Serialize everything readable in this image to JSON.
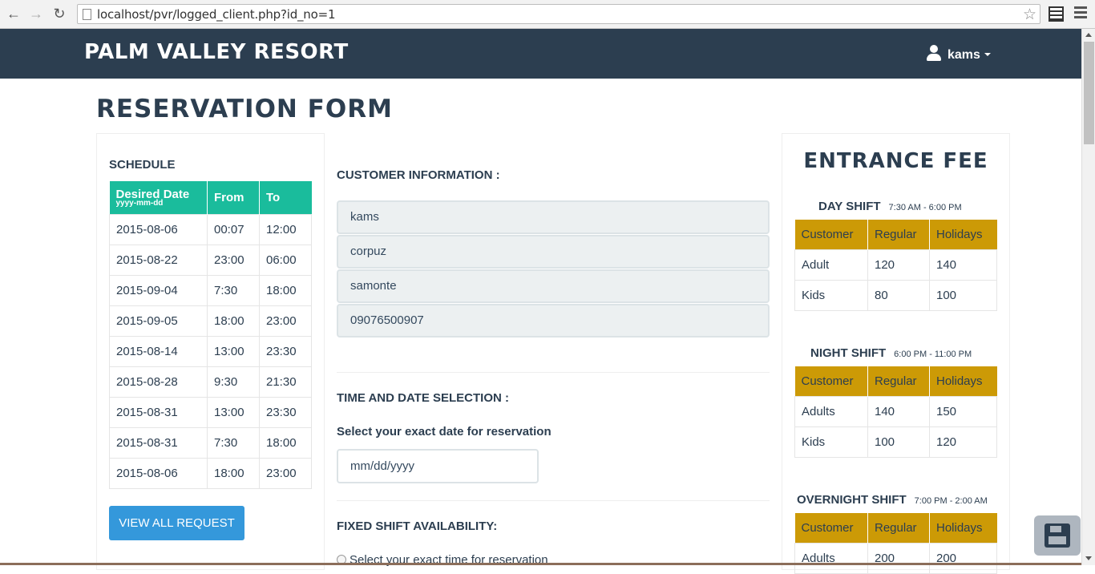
{
  "browser": {
    "url": "localhost/pvr/logged_client.php?id_no=1"
  },
  "navbar": {
    "brand": "PALM VALLEY RESORT",
    "user": "kams"
  },
  "page": {
    "title": "RESERVATION FORM"
  },
  "schedule": {
    "heading": "SCHEDULE",
    "columns": [
      "Desired Date",
      "From",
      "To"
    ],
    "date_hint": "yyyy-mm-dd",
    "rows": [
      [
        "2015-08-06",
        "00:07",
        "12:00"
      ],
      [
        "2015-08-22",
        "23:00",
        "06:00"
      ],
      [
        "2015-09-04",
        "7:30",
        "18:00"
      ],
      [
        "2015-09-05",
        "18:00",
        "23:00"
      ],
      [
        "2015-08-14",
        "13:00",
        "23:30"
      ],
      [
        "2015-08-28",
        "9:30",
        "21:30"
      ],
      [
        "2015-08-31",
        "13:00",
        "23:30"
      ],
      [
        "2015-08-31",
        "7:30",
        "18:00"
      ],
      [
        "2015-08-06",
        "18:00",
        "23:00"
      ]
    ],
    "button": "VIEW ALL REQUEST"
  },
  "customer": {
    "heading": "CUSTOMER INFORMATION :",
    "fields": [
      "kams",
      "corpuz",
      "samonte",
      "09076500907"
    ]
  },
  "time_date": {
    "heading": "TIME AND DATE SELECTION :",
    "prompt": "Select your exact date for reservation",
    "date_placeholder": "mm/dd/yyyy"
  },
  "fixed_shift": {
    "heading": "FIXED SHIFT AVAILABILITY:",
    "radio_label": "Select your exact time for reservation"
  },
  "fees": {
    "title": "ENTRANCE FEE",
    "columns": [
      "Customer",
      "Regular",
      "Holidays"
    ],
    "day": {
      "name": "DAY SHIFT",
      "time": "7:30 AM - 6:00 PM",
      "rows": [
        [
          "Adult",
          "120",
          "140"
        ],
        [
          "Kids",
          "80",
          "100"
        ]
      ]
    },
    "night": {
      "name": "NIGHT SHIFT",
      "time": "6:00 PM - 11:00 PM",
      "rows": [
        [
          "Adults",
          "140",
          "150"
        ],
        [
          "Kids",
          "100",
          "120"
        ]
      ]
    },
    "overnight": {
      "name": "OVERNIGHT SHIFT",
      "time": "7:00 PM - 2:00 AM",
      "rows": [
        [
          "Adults",
          "200",
          "200"
        ]
      ]
    }
  },
  "colors": {
    "navbar": "#2c3e50",
    "schedule_header": "#1abc9c",
    "fee_header": "#cc9a06",
    "button": "#3498db"
  },
  "icons": [
    "back-arrow-icon",
    "forward-arrow-icon",
    "reload-icon",
    "page-icon",
    "star-icon",
    "film-icon",
    "menu-icon",
    "user-icon",
    "caret-down-icon",
    "save-disk-icon"
  ]
}
